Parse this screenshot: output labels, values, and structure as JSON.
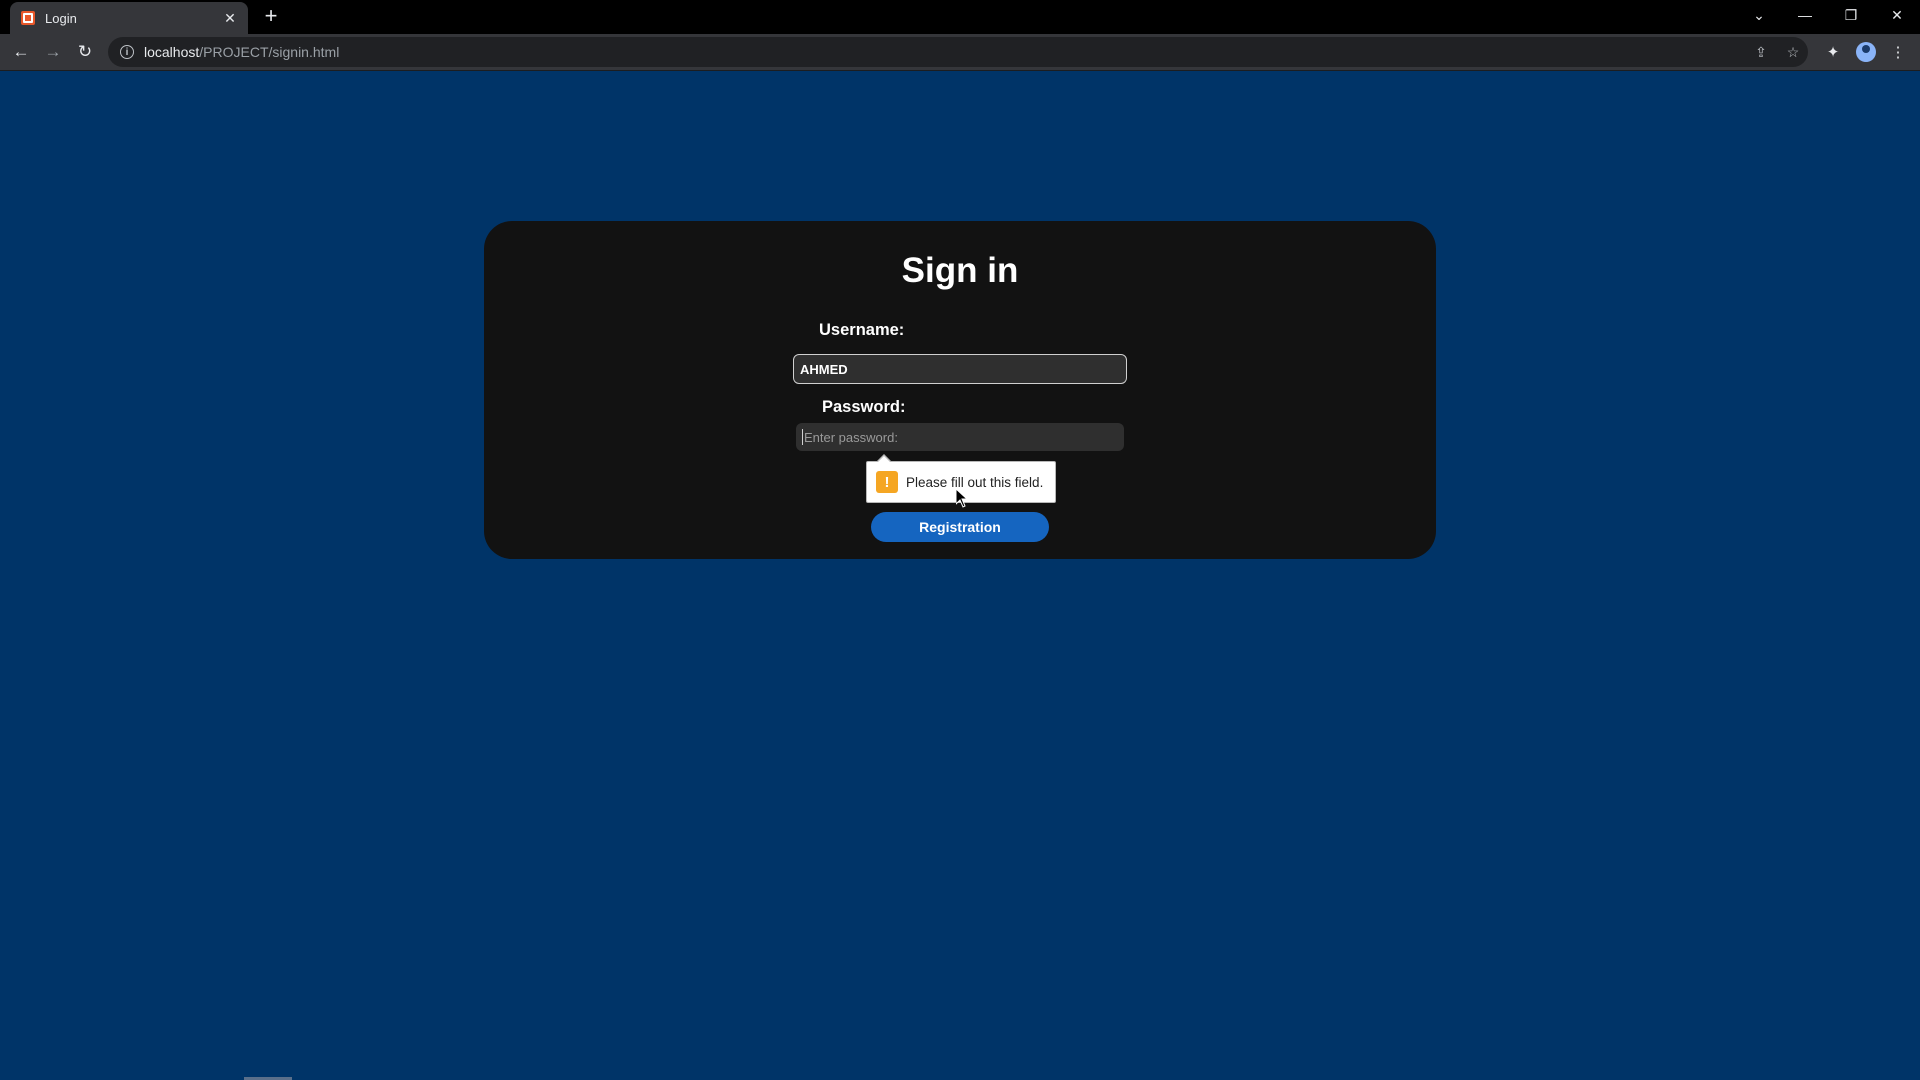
{
  "browser": {
    "tab_title": "Login",
    "tab_close": "✕",
    "new_tab": "+",
    "url_host": "localhost",
    "url_path": "/PROJECT/signin.html"
  },
  "form": {
    "title": "Sign in",
    "username_label": "Username:",
    "username_value": "AHMED",
    "password_label": "Password:",
    "password_placeholder": "Enter password:",
    "validation_message": "Please fill out this field.",
    "register_button": "Registration"
  },
  "colors": {
    "page_background": "#003468",
    "card_background": "#121212",
    "button": "#1565c0",
    "warning": "#f5a623"
  }
}
